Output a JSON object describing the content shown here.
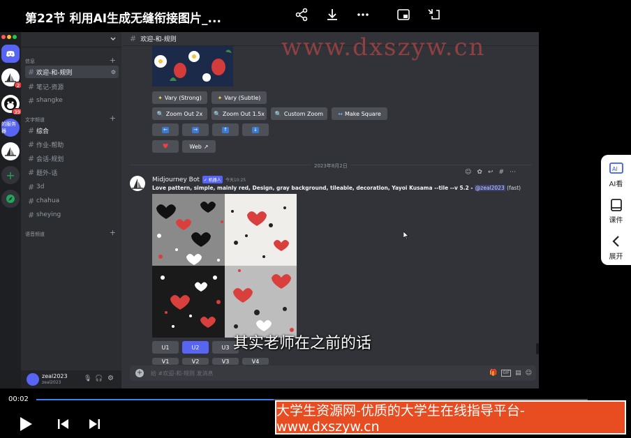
{
  "video": {
    "title": "第22节 利用AI生成无缝衔接图片_...",
    "time_current": "00:02",
    "progress": 0.43
  },
  "watermark": "www.dxszyw.cn",
  "subtitle": "其实老师在之前的话",
  "banner": "大学生资源网-优质的大学生在线指导平台-www.dxszyw.cn",
  "side_panel": {
    "ai_label": "AI看",
    "course_label": "课件",
    "expand_label": "展开"
  },
  "servers": [
    {
      "name": "discord-home",
      "badge": ""
    },
    {
      "name": "server-1",
      "badge": "2"
    },
    {
      "name": "server-2",
      "badge": "39"
    },
    {
      "name": "server-3",
      "text": "的服务器"
    },
    {
      "name": "server-4",
      "badge": ""
    }
  ],
  "sidebar": {
    "categories": [
      "信息",
      "文字频道",
      "语音频道"
    ],
    "channels_info": [
      "欢迎-和-规则",
      "笔记-资源",
      "shangke"
    ],
    "channels_text": [
      "综合",
      "作业-帮助",
      "会话-规划",
      "题外-话",
      "3d",
      "chahua",
      "sheying"
    ],
    "user": {
      "name": "zeal2023",
      "tag": "zeal2023"
    }
  },
  "main": {
    "channel_title": "欢迎-和-规则",
    "buttons_row1": [
      "Vary (Strong)",
      "Vary (Subtle)"
    ],
    "buttons_row2": [
      "Zoom Out 2x",
      "Zoom Out 1.5x",
      "Custom Zoom",
      "Make Square"
    ],
    "web_label": "Web",
    "date_divider": "2023年8月2日",
    "message": {
      "author": "Midjourney Bot",
      "bot_tag": "✓ 机器人",
      "time": "今天10:25",
      "prompt": "Love pattern, simple, mainly red, Design, gray background, tileable, decoration, Yayoi Kusama --tile --v 5.2 -",
      "mention": "@zeal2023",
      "mode": "(fast)"
    },
    "u_buttons": [
      "U1",
      "U2",
      "U3"
    ],
    "v_buttons": [
      "V1",
      "V2",
      "V3",
      "V4"
    ],
    "composer_placeholder": "给 #欢迎-和-规则 发消息"
  }
}
